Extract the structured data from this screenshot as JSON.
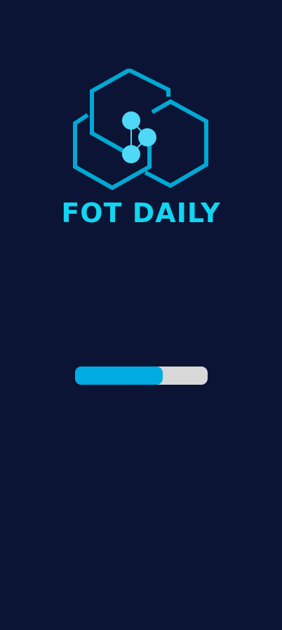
{
  "app": {
    "brand_name": "FOT DAILY",
    "logo_icon": "hexagon-molecule-logo-icon"
  },
  "loading": {
    "progress": 0.66
  },
  "colors": {
    "background": "#0B1434",
    "brand_text": "#10D6F2",
    "logo_stroke": "#00A9D4",
    "logo_nodes": "#4FD8F7",
    "progress_fill": "#00ABE2",
    "progress_track": "#D8D8D8"
  }
}
